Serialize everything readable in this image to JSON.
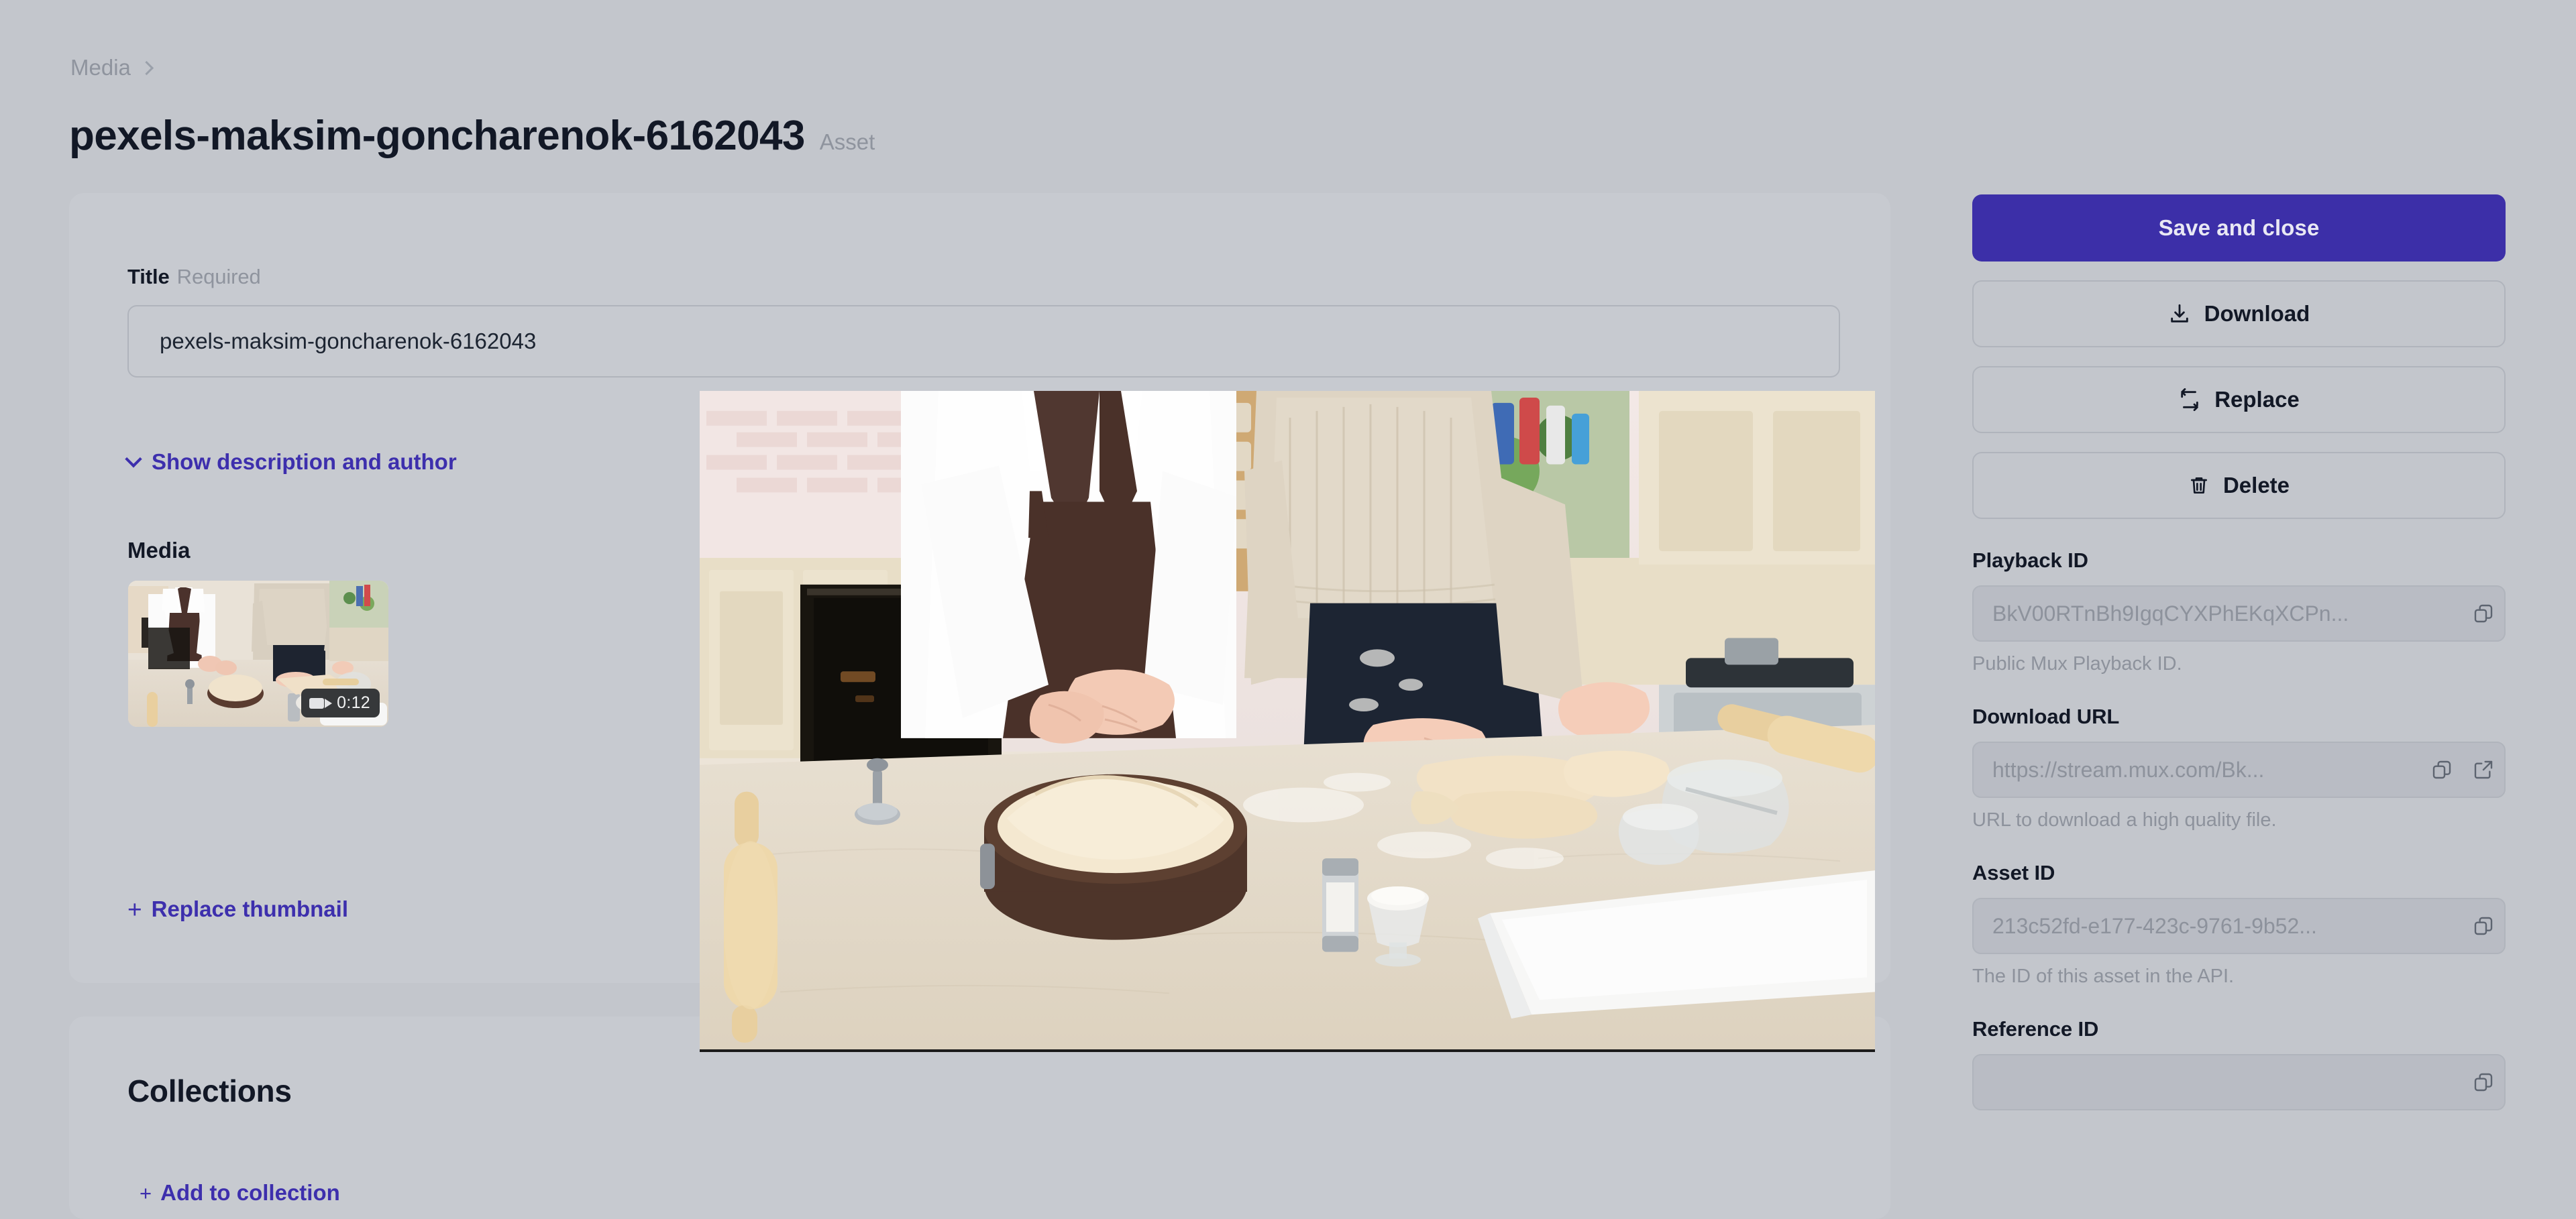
{
  "breadcrumb": {
    "root": "Media",
    "separator_icon": "chevron-right-icon"
  },
  "header": {
    "title": "pexels-maksim-goncharenok-6162043",
    "type_suffix": "Asset"
  },
  "form": {
    "title_field": {
      "label": "Title",
      "required_text": "Required",
      "value": "pexels-maksim-goncharenok-6162043",
      "placeholder": "Title"
    },
    "description_toggle": {
      "label": "Show description and author",
      "icon": "chevron-down-icon"
    },
    "media_section": {
      "label": "Media",
      "duration_badge": "0:12",
      "duration_icon": "video-camera-icon",
      "replace_thumbnail_label": "Replace thumbnail",
      "replace_thumbnail_icon": "plus-icon"
    }
  },
  "collections": {
    "title": "Collections",
    "add_label": "Add to collection",
    "add_icon": "plus-icon"
  },
  "actions": {
    "save": {
      "label": "Save and close"
    },
    "download": {
      "label": "Download",
      "icon": "download-icon"
    },
    "replace": {
      "label": "Replace",
      "icon": "swap-arrows-icon"
    },
    "delete": {
      "label": "Delete",
      "icon": "trash-icon"
    }
  },
  "metadata": [
    {
      "label": "Playback ID",
      "value": "BkV00RTnBh9IgqCYXPhEKqXCPn...",
      "help": "Public Mux Playback ID.",
      "copy_icon": "copy-icon",
      "has_external": false
    },
    {
      "label": "Download URL",
      "value": "https://stream.mux.com/Bk...",
      "help": "URL to download a high quality file.",
      "copy_icon": "copy-icon",
      "external_icon": "external-link-icon",
      "has_external": true
    },
    {
      "label": "Asset ID",
      "value": "213c52fd-e177-423c-9761-9b52...",
      "help": "The ID of this asset in the API.",
      "copy_icon": "copy-icon",
      "has_external": false
    },
    {
      "label": "Reference ID",
      "value": "",
      "help": "",
      "copy_icon": "copy-icon",
      "has_external": false
    }
  ],
  "colors": {
    "page_background": "#c3c6cc",
    "card_background": "#c7cad0",
    "accent": "#3d2fad",
    "primary_button": "#3c2fa8",
    "text_primary": "#121826",
    "text_muted": "#8f949e",
    "input_border": "#b0b4bc",
    "readonly_input_background": "#b9bcc4"
  }
}
